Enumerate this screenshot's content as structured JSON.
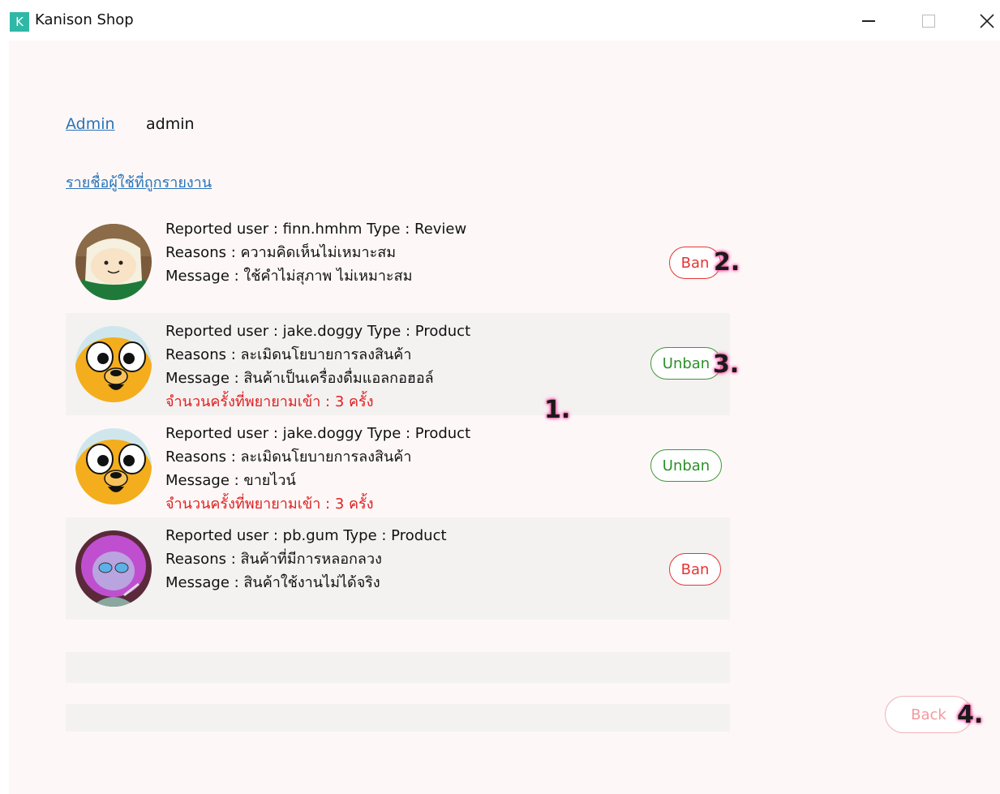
{
  "window": {
    "icon_letter": "K",
    "title": "Kanison Shop"
  },
  "breadcrumb": {
    "link": "Admin",
    "user": "admin"
  },
  "section_title": "รายชื่อผู้ใช้ที่ถูกรายงาน",
  "reports": [
    {
      "reported_line": "Reported user : finn.hmhm Type : Review",
      "reasons_line": "Reasons : ความคิดเห็นไม่เหมาะสม",
      "message_line": "Message : ใช้คำไม่สุภาพ ไม่เหมาะสม",
      "attempts_line": "",
      "action_label": "Ban",
      "avatar_icon": "finn-avatar"
    },
    {
      "reported_line": "Reported user : jake.doggy Type : Product",
      "reasons_line": "Reasons : ละเมิดนโยบายการลงสินค้า",
      "message_line": "Message : สินค้าเป็นเครื่องดื่มแอลกอฮอล์",
      "attempts_line": "จำนวนครั้งที่พยายามเข้า : 3 ครั้ง",
      "action_label": "Unban",
      "avatar_icon": "jake-avatar"
    },
    {
      "reported_line": "Reported user : jake.doggy Type : Product",
      "reasons_line": "Reasons : ละเมิดนโยบายการลงสินค้า",
      "message_line": "Message : ขายไวน์",
      "attempts_line": "จำนวนครั้งที่พยายามเข้า : 3 ครั้ง",
      "action_label": "Unban",
      "avatar_icon": "jake-avatar"
    },
    {
      "reported_line": "Reported user : pb.gum Type : Product",
      "reasons_line": "Reasons : สินค้าที่มีการหลอกลวง",
      "message_line": "Message : สินค้าใช้งานไม่ได้จริง",
      "attempts_line": "",
      "action_label": "Ban",
      "avatar_icon": "pb-avatar"
    }
  ],
  "back_label": "Back",
  "annotations": [
    "1.",
    "2.",
    "3.",
    "4."
  ],
  "colors": {
    "link": "#2a73b8",
    "ban": "#e63434",
    "unban": "#2e8f2a",
    "warning": "#e02020",
    "marker_glow": "#ff5fae"
  }
}
